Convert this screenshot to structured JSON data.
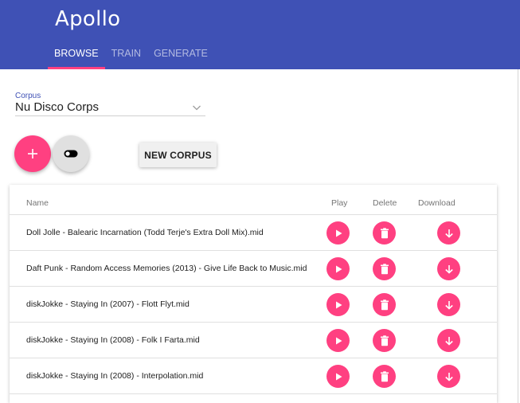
{
  "app": {
    "title": "Apollo"
  },
  "tabs": [
    {
      "label": "BROWSE",
      "active": true
    },
    {
      "label": "TRAIN",
      "active": false
    },
    {
      "label": "GENERATE",
      "active": false
    }
  ],
  "corpus": {
    "label": "Corpus",
    "value": "Nu Disco Corps"
  },
  "buttons": {
    "new_corpus": "NEW CORPUS",
    "add_icon": "plus-icon",
    "toggle_icon": "toggle-icon"
  },
  "table": {
    "headers": {
      "name": "Name",
      "play": "Play",
      "delete": "Delete",
      "download": "Download"
    },
    "rows": [
      {
        "name": "Doll Jolle - Balearic Incarnation (Todd Terje's Extra Doll Mix).mid"
      },
      {
        "name": "Daft Punk - Random Access Memories (2013) - Give Life Back to Music.mid"
      },
      {
        "name": "diskJokke - Staying In (2007) - Flott Flyt.mid"
      },
      {
        "name": "diskJokke - Staying In (2008) - Folk I Farta.mid"
      },
      {
        "name": "diskJokke - Staying In (2008) - Interpolation.mid"
      }
    ]
  },
  "colors": {
    "primary": "#3f51b5",
    "accent": "#ff4081"
  }
}
